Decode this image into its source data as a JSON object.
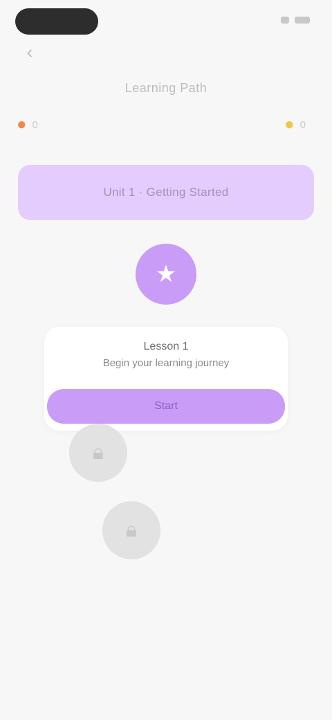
{
  "status": {
    "time": "",
    "icons": [
      "signal-icon",
      "battery-icon"
    ]
  },
  "header": {
    "back_icon": "chevron-left-icon",
    "title": "Learning Path"
  },
  "stats": {
    "streak": {
      "icon": "flame-icon",
      "value": "0"
    },
    "coins": {
      "icon": "coin-icon",
      "value": "0"
    }
  },
  "banner": {
    "text": "Unit 1 · Getting Started"
  },
  "path": {
    "active_node": {
      "icon": "star-icon"
    },
    "popup": {
      "title": "Lesson 1",
      "subtitle": "Begin your learning journey",
      "button_label": "Start"
    },
    "locked_nodes": [
      {
        "icon": "lock-icon"
      },
      {
        "icon": "lock-icon"
      }
    ]
  },
  "colors": {
    "accent": "#c99cf7",
    "banner_bg": "#e5ccff",
    "locked": "#e2e2e2",
    "background": "#f7f7f7"
  }
}
